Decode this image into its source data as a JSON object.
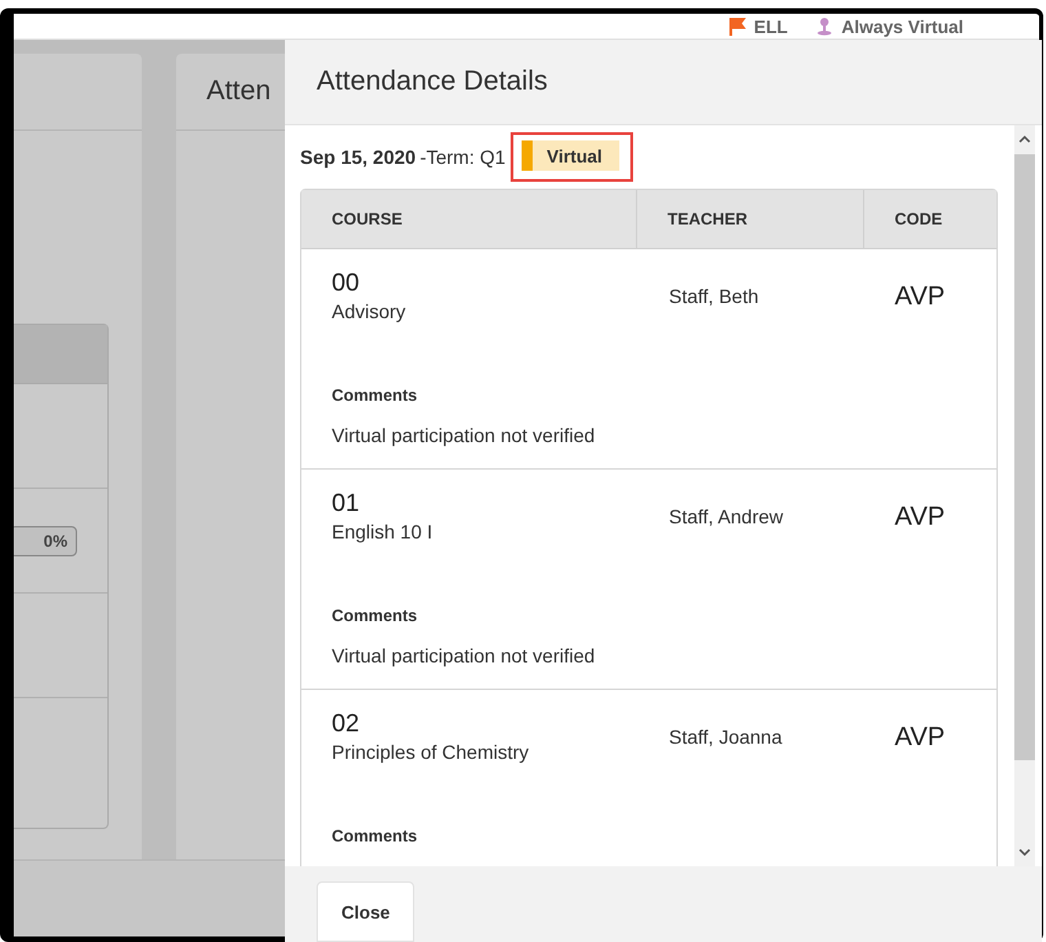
{
  "top_bar": {
    "flags": [
      {
        "kind": "flag",
        "label": "ELL"
      },
      {
        "kind": "pin",
        "label": "Always Virtual"
      }
    ]
  },
  "background": {
    "panel_title": "Atten",
    "progress_badge": "0%"
  },
  "modal": {
    "title": "Attendance Details",
    "date": "Sep 15, 2020",
    "term": "-Term: Q1",
    "status": {
      "label": "Virtual",
      "color": "#f5a800",
      "highlighted": true
    },
    "table": {
      "columns": [
        "COURSE",
        "TEACHER",
        "CODE"
      ],
      "rows": [
        {
          "period": "00",
          "course": "Advisory",
          "teacher": "Staff, Beth",
          "code": "AVP",
          "comments_label": "Comments",
          "comment": "Virtual participation not verified"
        },
        {
          "period": "01",
          "course": "English 10 I",
          "teacher": "Staff, Andrew",
          "code": "AVP",
          "comments_label": "Comments",
          "comment": "Virtual participation not verified"
        },
        {
          "period": "02",
          "course": "Principles of Chemistry",
          "teacher": "Staff, Joanna",
          "code": "AVP",
          "comments_label": "Comments"
        }
      ]
    },
    "buttons": [
      "Close"
    ]
  }
}
